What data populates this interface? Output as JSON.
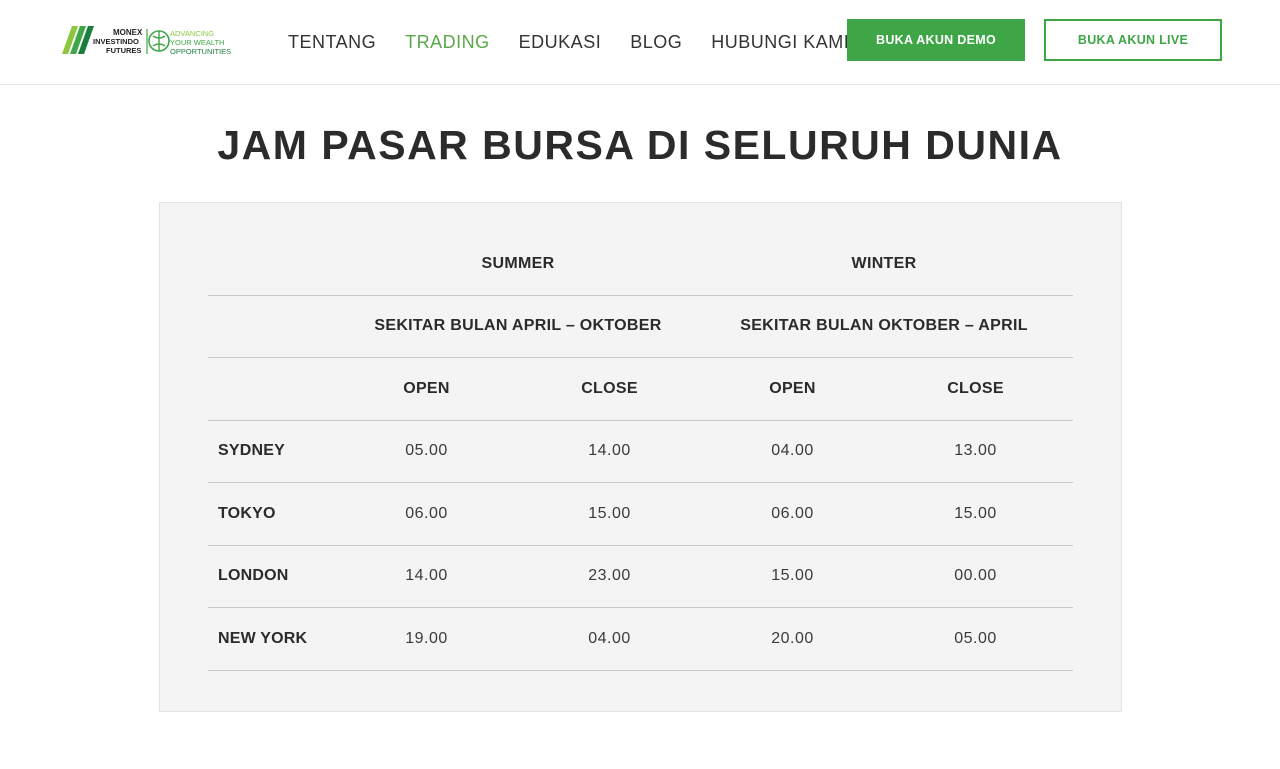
{
  "header": {
    "logo": {
      "brand_line1": "MONEX",
      "brand_line2": "INVESTINDO",
      "brand_line3": "FUTURES",
      "tagline_line1": "ADVANCING",
      "tagline_line2": "YOUR WEALTH",
      "tagline_line3": "OPPORTUNITIES"
    },
    "nav": [
      {
        "label": "TENTANG",
        "active": false
      },
      {
        "label": "TRADING",
        "active": true
      },
      {
        "label": "EDUKASI",
        "active": false
      },
      {
        "label": "BLOG",
        "active": false
      },
      {
        "label": "HUBUNGI KAMI",
        "active": false
      }
    ],
    "demo_button": "BUKA AKUN DEMO",
    "live_button": "BUKA AKUN LIVE"
  },
  "colors": {
    "accent_green": "#3fa648",
    "active_nav": "#5aa84a",
    "panel_bg": "#f4f4f4"
  },
  "page_title": "JAM PASAR BURSA DI SELURUH DUNIA",
  "table": {
    "season_headers": {
      "summer": "SUMMER",
      "winter": "WINTER"
    },
    "period_headers": {
      "summer": "SEKITAR BULAN APRIL – OKTOBER",
      "winter": "SEKITAR BULAN OKTOBER – APRIL"
    },
    "column_headers": {
      "summer_open": "OPEN",
      "summer_close": "CLOSE",
      "winter_open": "OPEN",
      "winter_close": "CLOSE"
    },
    "rows": [
      {
        "city": "SYDNEY",
        "summer_open": "05.00",
        "summer_close": "14.00",
        "winter_open": "04.00",
        "winter_close": "13.00"
      },
      {
        "city": "TOKYO",
        "summer_open": "06.00",
        "summer_close": "15.00",
        "winter_open": "06.00",
        "winter_close": "15.00"
      },
      {
        "city": "LONDON",
        "summer_open": "14.00",
        "summer_close": "23.00",
        "winter_open": "15.00",
        "winter_close": "00.00"
      },
      {
        "city": "NEW YORK",
        "summer_open": "19.00",
        "summer_close": "04.00",
        "winter_open": "20.00",
        "winter_close": "05.00"
      }
    ]
  }
}
